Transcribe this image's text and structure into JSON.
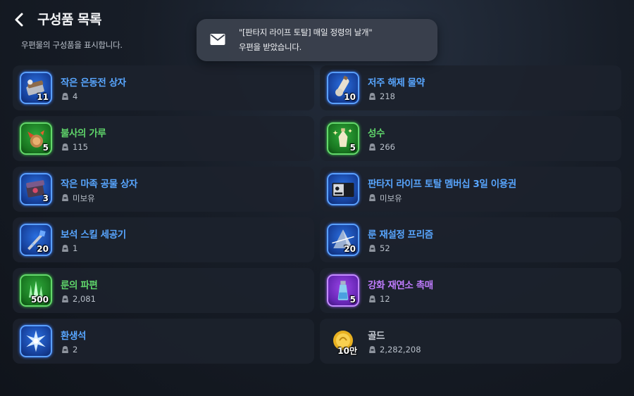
{
  "header": {
    "title": "구성품 목록",
    "subtitle": "우편물의 구성품을 표시합니다."
  },
  "toast": {
    "line1": "\"[판타지 라이프 토탈] 매일 정령의 날개\"",
    "line2": "우편을 받았습니다."
  },
  "colors": {
    "rare_blue": "#58a6ff",
    "uncommon_green": "#5fd46a",
    "epic_purple": "#c07cff"
  },
  "items": [
    {
      "name": "작은 은동전 상자",
      "qty": "11",
      "owned": "4",
      "grade": "blue",
      "icon": "coin-box-icon"
    },
    {
      "name": "저주 해제 물약",
      "qty": "10",
      "owned": "218",
      "grade": "blue",
      "icon": "potion-icon"
    },
    {
      "name": "불사의 가루",
      "qty": "5",
      "owned": "115",
      "grade": "green",
      "icon": "dust-icon"
    },
    {
      "name": "성수",
      "qty": "5",
      "owned": "266",
      "grade": "green",
      "icon": "holy-water-icon"
    },
    {
      "name": "작은 마족 공물 상자",
      "qty": "3",
      "owned": "미보유",
      "grade": "blue",
      "icon": "demon-box-icon"
    },
    {
      "name": "판타지 라이프 토탈 멤버십 3일 이용권",
      "qty": "",
      "owned": "미보유",
      "grade": "blue",
      "icon": "membership-ticket-icon"
    },
    {
      "name": "보석 스킬 세공기",
      "qty": "20",
      "owned": "1",
      "grade": "blue",
      "icon": "gem-tool-icon"
    },
    {
      "name": "룬 재설정 프리즘",
      "qty": "20",
      "owned": "52",
      "grade": "blue",
      "icon": "prism-icon"
    },
    {
      "name": "룬의 파편",
      "qty": "500",
      "owned": "2,081",
      "grade": "green",
      "icon": "rune-shard-icon"
    },
    {
      "name": "강화 재연소 촉매",
      "qty": "5",
      "owned": "12",
      "grade": "purple",
      "icon": "catalyst-icon"
    },
    {
      "name": "환생석",
      "qty": "",
      "owned": "2",
      "grade": "blue",
      "icon": "rebirth-stone-icon"
    },
    {
      "name": "골드",
      "qty": "10만",
      "owned": "2,282,208",
      "grade": "gray",
      "icon": "gold-coin-icon"
    }
  ]
}
